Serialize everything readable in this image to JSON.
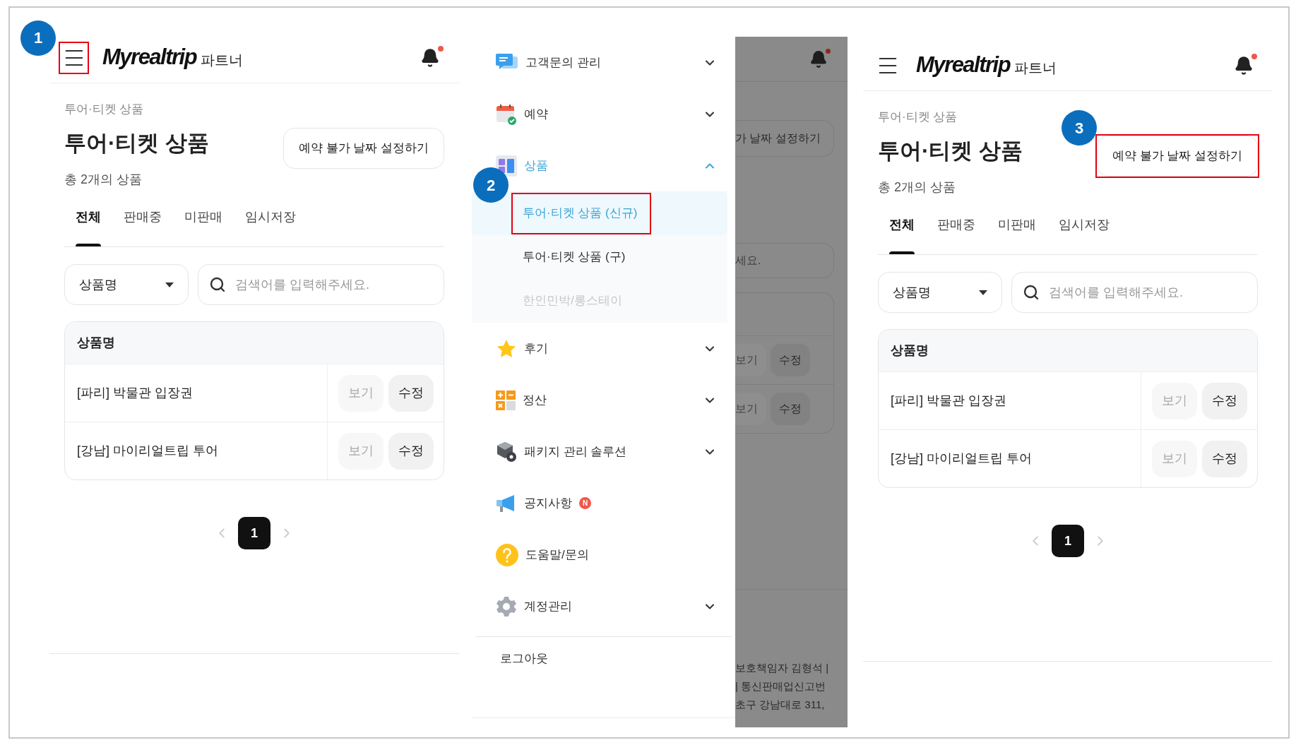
{
  "screens": [
    {
      "brand": "Myrealtrip",
      "brand_suffix": "파트너",
      "breadcrumb": "투어·티켓 상품",
      "title": "투어·티켓 상품",
      "count": "총 2개의 상품",
      "action_button": "예약 불가 날짜 설정하기",
      "tabs": [
        {
          "label": "전체",
          "selected": true
        },
        {
          "label": "판매중",
          "selected": false
        },
        {
          "label": "미판매",
          "selected": false
        },
        {
          "label": "임시저장",
          "selected": false
        }
      ],
      "filter": "상품명",
      "search": {
        "placeholder": "검색어를 입력해주세요."
      },
      "table": {
        "column": "상품명",
        "rows": [
          {
            "name": "[파리] 박물관 입장권",
            "actions": [
              {
                "label": "보기",
                "disabled": true
              },
              {
                "label": "수정",
                "disabled": false
              }
            ]
          },
          {
            "name": "[강남] 마이리얼트립 투어",
            "actions": [
              {
                "label": "보기",
                "disabled": true
              },
              {
                "label": "수정",
                "disabled": false
              }
            ]
          }
        ]
      },
      "pages": [
        {
          "label": "1",
          "selected": true
        }
      ],
      "callout": {
        "number": "1",
        "kind": "menu"
      }
    },
    {
      "brand": "Myrealtrip",
      "brand_suffix": "파트너",
      "breadcrumb": "투어·티켓 상품",
      "title": "투어·티켓 상품",
      "count": "총 2개의 상품",
      "action_button": "예약 불가 날짜 설정하기",
      "tabs": [
        {
          "label": "전체",
          "selected": true
        },
        {
          "label": "판매중",
          "selected": false
        },
        {
          "label": "미판매",
          "selected": false
        },
        {
          "label": "임시저장",
          "selected": false
        }
      ],
      "filter": "상품명",
      "search": {
        "placeholder": "검색어를 입력해주세요."
      },
      "table": {
        "column": "상품명",
        "rows": [
          {
            "name": "[파리] 박물관 입장권",
            "actions": [
              {
                "label": "보기",
                "disabled": true
              },
              {
                "label": "수정",
                "disabled": false
              }
            ]
          },
          {
            "name": "[강남] 마이리얼트립 투어",
            "actions": [
              {
                "label": "보기",
                "disabled": true
              },
              {
                "label": "수정",
                "disabled": false
              }
            ]
          }
        ]
      },
      "pages": [
        {
          "label": "1",
          "selected": true
        }
      ],
      "callout": {
        "number": "3",
        "kind": "action"
      }
    }
  ],
  "drawer": {
    "items": [
      {
        "label": "고객문의 관리",
        "kind": "chat",
        "expanded": false
      },
      {
        "label": "예약",
        "kind": "calendar",
        "expanded": false
      },
      {
        "label": "상품",
        "kind": "grid",
        "expanded": true,
        "children": [
          {
            "label": "투어·티켓 상품 (신규)",
            "selected": true,
            "disabled": false,
            "callout": {
              "number": "2"
            }
          },
          {
            "label": "투어·티켓 상품 (구)",
            "selected": false,
            "disabled": false
          },
          {
            "label": "한인민박/롱스테이",
            "selected": false,
            "disabled": true
          }
        ]
      },
      {
        "label": "후기",
        "kind": "star",
        "expanded": false
      },
      {
        "label": "정산",
        "kind": "calculator",
        "expanded": false
      },
      {
        "label": "패키지 관리 솔루션",
        "kind": "box",
        "expanded": false
      },
      {
        "label": "공지사항",
        "kind": "megaphone",
        "badge": "N"
      },
      {
        "label": "도움말/문의",
        "kind": "help"
      },
      {
        "label": "계정관리",
        "kind": "gear",
        "expanded": false
      }
    ],
    "logout": "로그아웃"
  },
  "dimmed_page": {
    "action_fragment": "가 날짜 설정하기",
    "search_fragment": "세요.",
    "rows": [
      {
        "view": "보기",
        "edit": "수정"
      },
      {
        "view": "보기",
        "edit": "수정"
      }
    ],
    "footer_lines": [
      "보호책임자 김형석 |",
      "| 통신판매업신고번",
      "초구 강남대로 311,"
    ]
  }
}
